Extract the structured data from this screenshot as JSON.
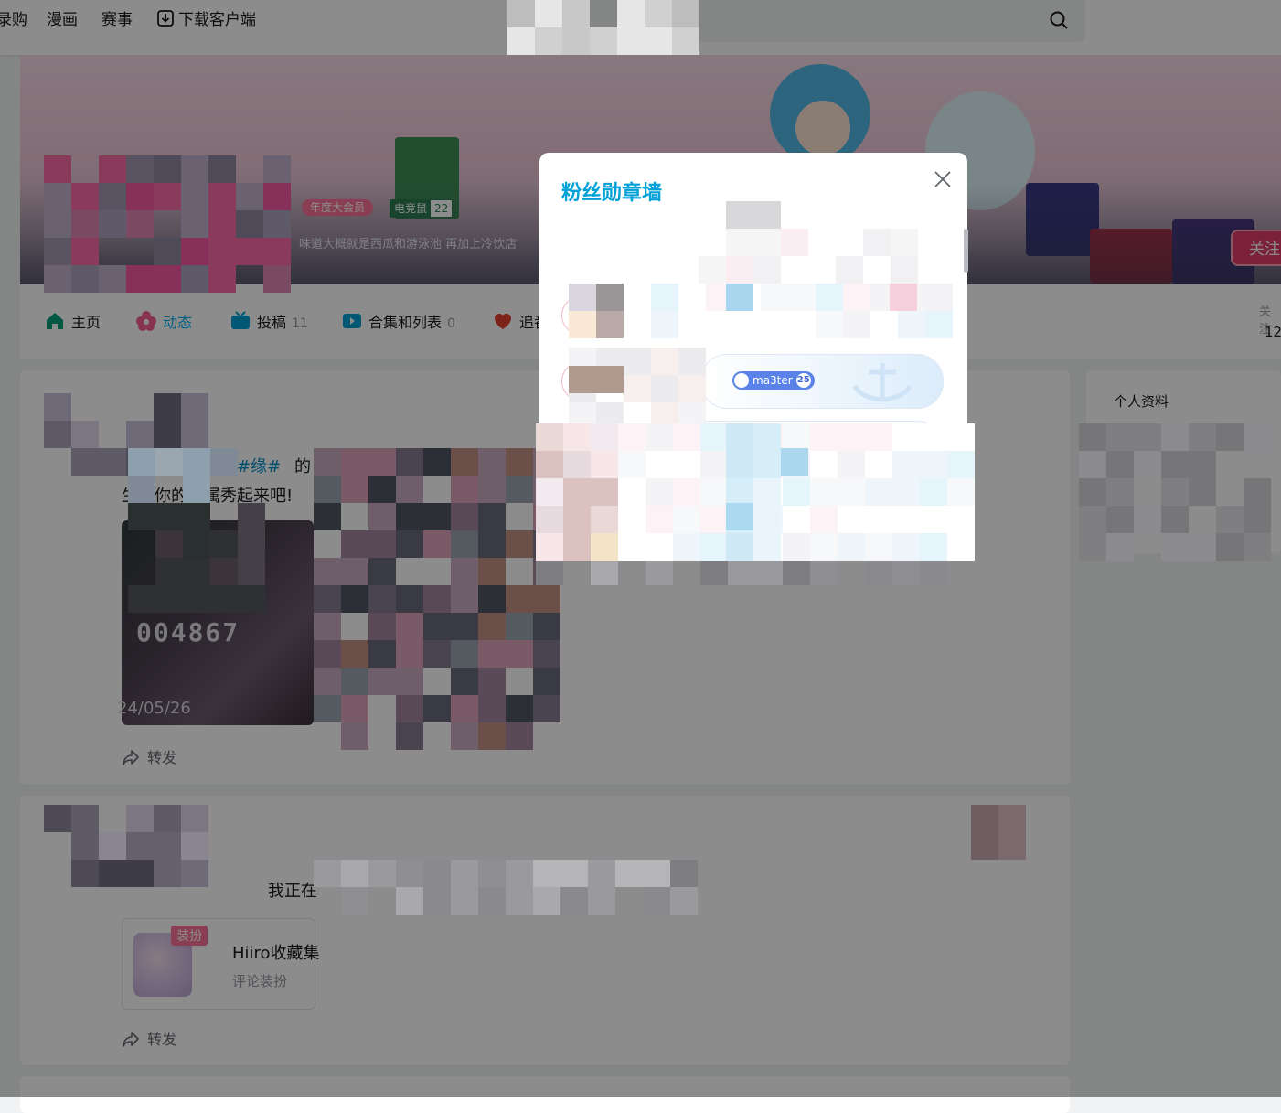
{
  "topnav": {
    "items": [
      "录购",
      "漫画",
      "赛事"
    ],
    "download_label": "下载客户端"
  },
  "banner": {
    "vip_badge": "年度大会员",
    "medal_name": "电竞鼠",
    "medal_level": "22",
    "signature": "味道大概就是西瓜和游泳池 再加上冷饮店",
    "follow_button": "关注"
  },
  "tabs": [
    {
      "label": "主页",
      "count": ""
    },
    {
      "label": "动态",
      "count": ""
    },
    {
      "label": "投稿",
      "count": "11"
    },
    {
      "label": "合集和列表",
      "count": "0"
    },
    {
      "label": "追番",
      "count": ""
    }
  ],
  "stats": {
    "label": "关注",
    "value": "12"
  },
  "feed": {
    "post1_topic": "#缘#",
    "post1_topic_suffix": "的",
    "post1_line": "生成你的专属秀起来吧!",
    "card_serial": "004867",
    "card_date": "24/05/26",
    "repost_label": "转发",
    "post2_line": "我正在",
    "deco_tag": "装扮",
    "deco_title": "Hiiro收藏集",
    "deco_sub": "评论装扮"
  },
  "sidebar": {
    "title": "个人资料"
  },
  "modal": {
    "title": "粉丝勋章墙",
    "medal_name": "ma3ter",
    "medal_level": "25"
  },
  "colors": {
    "accent": "#00aeec",
    "pink": "#fb7299",
    "overlay": "rgba(0,0,0,0.45)"
  }
}
